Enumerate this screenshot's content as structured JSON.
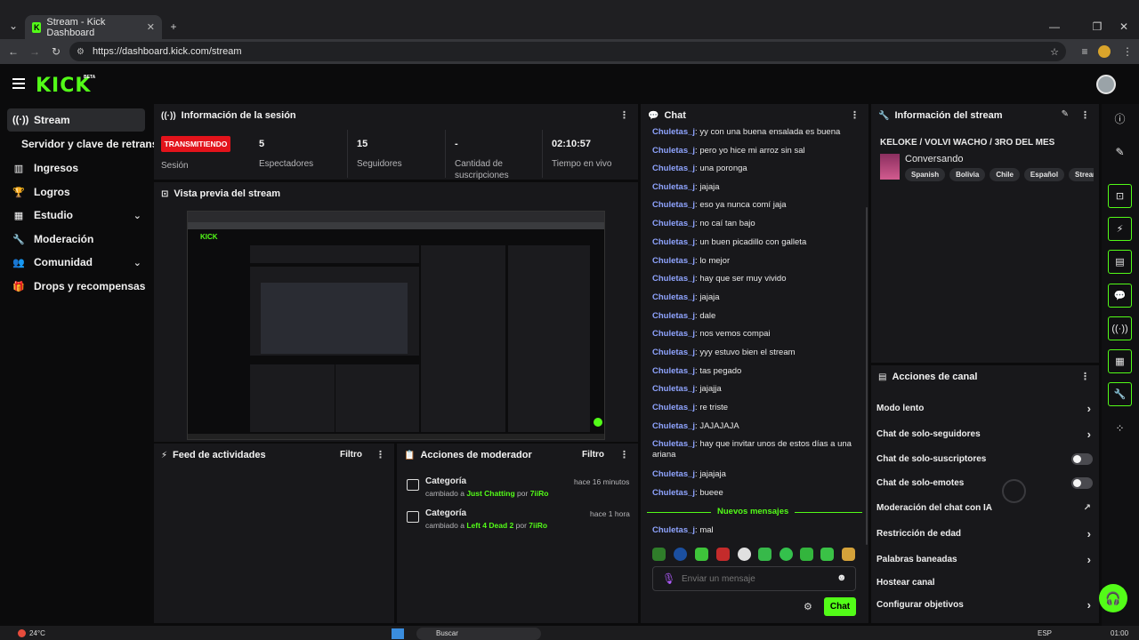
{
  "browser": {
    "tab_title": "Stream - Kick Dashboard",
    "url": "https://dashboard.kick.com/stream"
  },
  "app": {
    "logo": "KICK",
    "beta": "BETA"
  },
  "sidebar": {
    "items": [
      {
        "label": "Stream",
        "icon": "broadcast-icon"
      },
      {
        "label": "Servidor y clave de retransm",
        "icon": ""
      },
      {
        "label": "Ingresos",
        "icon": "chart-icon"
      },
      {
        "label": "Logros",
        "icon": "trophy-icon"
      },
      {
        "label": "Estudio",
        "icon": "studio-icon"
      },
      {
        "label": "Moderación",
        "icon": "wrench-icon"
      },
      {
        "label": "Comunidad",
        "icon": "people-icon"
      },
      {
        "label": "Drops y recompensas",
        "icon": "gift-icon"
      }
    ]
  },
  "session": {
    "title": "Información de la sesión",
    "badge": "TRANSMITIENDO",
    "badge_label": "Sesión",
    "stats": [
      {
        "value": "5",
        "label": "Espectadores"
      },
      {
        "value": "15",
        "label": "Seguidores"
      },
      {
        "value": "-",
        "label": "Cantidad de suscripciones"
      },
      {
        "value": "02:10:57",
        "label": "Tiempo en vivo"
      }
    ]
  },
  "preview": {
    "title": "Vista previa del stream"
  },
  "activity": {
    "title": "Feed de actividades",
    "filter": "Filtro"
  },
  "modactions": {
    "title": "Acciones de moderador",
    "filter": "Filtro",
    "entries": [
      {
        "title": "Categoría",
        "time": "hace 16 minutos",
        "prefix": "cambiado a",
        "game": "Just Chatting",
        "by": "por",
        "user": "7iiRo"
      },
      {
        "title": "Categoría",
        "time": "hace 1 hora",
        "prefix": "cambiado a",
        "game": "Left 4 Dead 2",
        "by": "por",
        "user": "7iiRo"
      }
    ]
  },
  "chat": {
    "title": "Chat",
    "messages": [
      {
        "user": "Chuletas_j",
        "text": ": yy con una buena ensalada es buena"
      },
      {
        "user": "Chuletas_j",
        "text": ": pero yo hice mi arroz sin sal"
      },
      {
        "user": "Chuletas_j",
        "text": ": una poronga"
      },
      {
        "user": "Chuletas_j",
        "text": ": jajaja"
      },
      {
        "user": "Chuletas_j",
        "text": ": eso ya nunca comí jaja"
      },
      {
        "user": "Chuletas_j",
        "text": ": no caí tan bajo"
      },
      {
        "user": "Chuletas_j",
        "text": ": un buen picadillo con galleta"
      },
      {
        "user": "Chuletas_j",
        "text": ": lo mejor"
      },
      {
        "user": "Chuletas_j",
        "text": ": hay que ser muy vivido"
      },
      {
        "user": "Chuletas_j",
        "text": ": jajaja"
      },
      {
        "user": "Chuletas_j",
        "text": ": dale"
      },
      {
        "user": "Chuletas_j",
        "text": ": nos vemos compai"
      },
      {
        "user": "Chuletas_j",
        "text": ": yyy estuvo bien el stream"
      },
      {
        "user": "Chuletas_j",
        "text": ": tas pegado"
      },
      {
        "user": "Chuletas_j",
        "text": ": jajajja"
      },
      {
        "user": "Chuletas_j",
        "text": ": re triste"
      },
      {
        "user": "Chuletas_j",
        "text": ": JAJAJAJA"
      },
      {
        "user": "Chuletas_j",
        "text": ": hay que invitar unos de estos días a una ariana"
      },
      {
        "user": "Chuletas_j",
        "text": ": jajajaja"
      },
      {
        "user": "Chuletas_j",
        "text": ": bueee"
      }
    ],
    "new_messages": "Nuevos mensajes",
    "last": {
      "user": "Chuletas_j",
      "text": ": mal"
    },
    "placeholder": "Enviar un mensaje",
    "send": "Chat"
  },
  "streaminfo": {
    "title": "Información del stream",
    "stream_title": "KELOKE / VOLVI WACHO / 3RO DEL MES",
    "category": "Conversando",
    "tags": [
      "Spanish",
      "Bolivia",
      "Chile",
      "Español",
      "Streame"
    ]
  },
  "channel_actions": {
    "title": "Acciones de canal",
    "items": [
      {
        "label": "Modo lento",
        "control": "arrow"
      },
      {
        "label": "Chat de solo-seguidores",
        "control": "arrow"
      },
      {
        "label": "Chat de solo-suscriptores",
        "control": "toggle"
      },
      {
        "label": "Chat de solo-emotes",
        "control": "toggle"
      },
      {
        "label": "Moderación del chat con IA",
        "control": "external"
      },
      {
        "label": "Restricción de edad",
        "control": "arrow"
      },
      {
        "label": "Palabras baneadas",
        "control": "arrow"
      },
      {
        "label": "Hostear canal",
        "control": "none"
      },
      {
        "label": "Configurar objetivos",
        "control": "arrow"
      }
    ]
  },
  "taskbar": {
    "weather": "24°C",
    "search": "Buscar",
    "lang": "ESP",
    "time": "01:00"
  },
  "colors": {
    "accent": "#53fc18",
    "live": "#e3131b",
    "username": "#8fa4ff",
    "panel": "#18181b"
  }
}
